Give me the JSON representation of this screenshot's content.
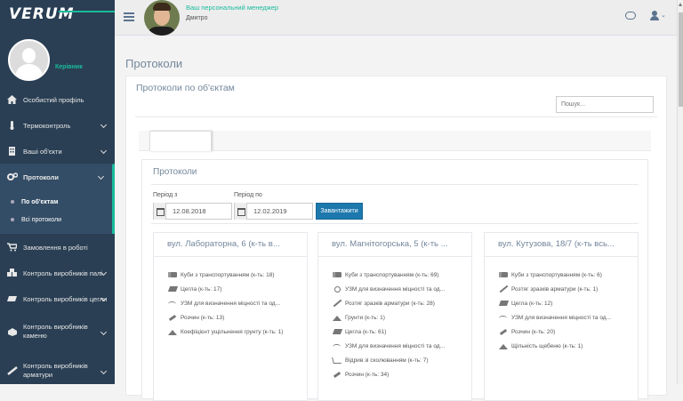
{
  "brand": {
    "logo_text": "VERUM"
  },
  "sidebar": {
    "user_name": "Керівник",
    "items": [
      {
        "label": "Особистий профіль"
      },
      {
        "label": "Термоконтроль"
      },
      {
        "label": "Ваші об'єкти"
      },
      {
        "label": "Протоколи"
      },
      {
        "label": "Замовлення в роботі"
      },
      {
        "label": "Контроль виробників палі"
      },
      {
        "label": "Контроль виробників цегли"
      },
      {
        "label": "Контроль виробників каменю"
      },
      {
        "label": "Контроль виробників арматури"
      }
    ],
    "sub_items": [
      {
        "label": "По об'єктам"
      },
      {
        "label": "Всі протоколи"
      }
    ]
  },
  "topbar": {
    "manager_title": "Ваш персональний менеджер",
    "manager_name": "Дмитро"
  },
  "main": {
    "page_title": "Протоколи",
    "panel_title": "Протоколи по об'єктам",
    "search_placeholder": "Пошук...",
    "inner_title": "Протоколи",
    "period_from_label": "Період з",
    "period_to_label": "Період по",
    "period_from": "12.08.2018",
    "period_to": "12.02.2019",
    "load_button": "Завантажити"
  },
  "cards": [
    {
      "title": "вул. Лабораторна, 6 (к-ть в...",
      "rows": [
        {
          "icon": "cubes-icon",
          "text": "Куби з транспортуванням (к-ть: 18)"
        },
        {
          "icon": "brick-icon",
          "text": "Цегла (к-ть: 17)"
        },
        {
          "icon": "arc-icon",
          "text": "УЗМ для визначення міцності та од..."
        },
        {
          "icon": "trowel-icon",
          "text": "Розчин (к-ть: 13)"
        },
        {
          "icon": "pile-icon",
          "text": "Коефіцієнт ущільнення грунту (к-ть: 1)"
        }
      ]
    },
    {
      "title": "вул. Магнітогорська, 5 (к-ть ...",
      "rows": [
        {
          "icon": "cubes-icon",
          "text": "Куби з транспортуванням (к-ть: 69)"
        },
        {
          "icon": "valve-icon",
          "text": "УЗМ для визначення міцності та од..."
        },
        {
          "icon": "rebar-icon",
          "text": "Розтяг зразків арматури (к-ть: 28)"
        },
        {
          "icon": "pile-icon",
          "text": "Грунти (к-ть: 1)"
        },
        {
          "icon": "brick-icon",
          "text": "Цегла (к-ть: 61)"
        },
        {
          "icon": "arc-icon",
          "text": "УЗМ для визначення міцності та од..."
        },
        {
          "icon": "slope-icon",
          "text": "Відрив зі сколюванням (к-ть: 7)"
        },
        {
          "icon": "trowel-icon",
          "text": "Розчин (к-ть: 34)"
        }
      ]
    },
    {
      "title": "вул. Кутузова, 18/7 (к-ть всь...",
      "rows": [
        {
          "icon": "cubes-icon",
          "text": "Куби з транспортуванням (к-ть: 6)"
        },
        {
          "icon": "rebar-icon",
          "text": "Розтяг зразків арматури (к-ть: 1)"
        },
        {
          "icon": "brick-icon",
          "text": "Цегла (к-ть: 12)"
        },
        {
          "icon": "arc-icon",
          "text": "УЗМ для визначення міцності та од..."
        },
        {
          "icon": "trowel-icon",
          "text": "Розчин (к-ть: 20)"
        },
        {
          "icon": "pile-icon",
          "text": "Щільність щебеню (к-ть: 1)"
        }
      ]
    }
  ]
}
